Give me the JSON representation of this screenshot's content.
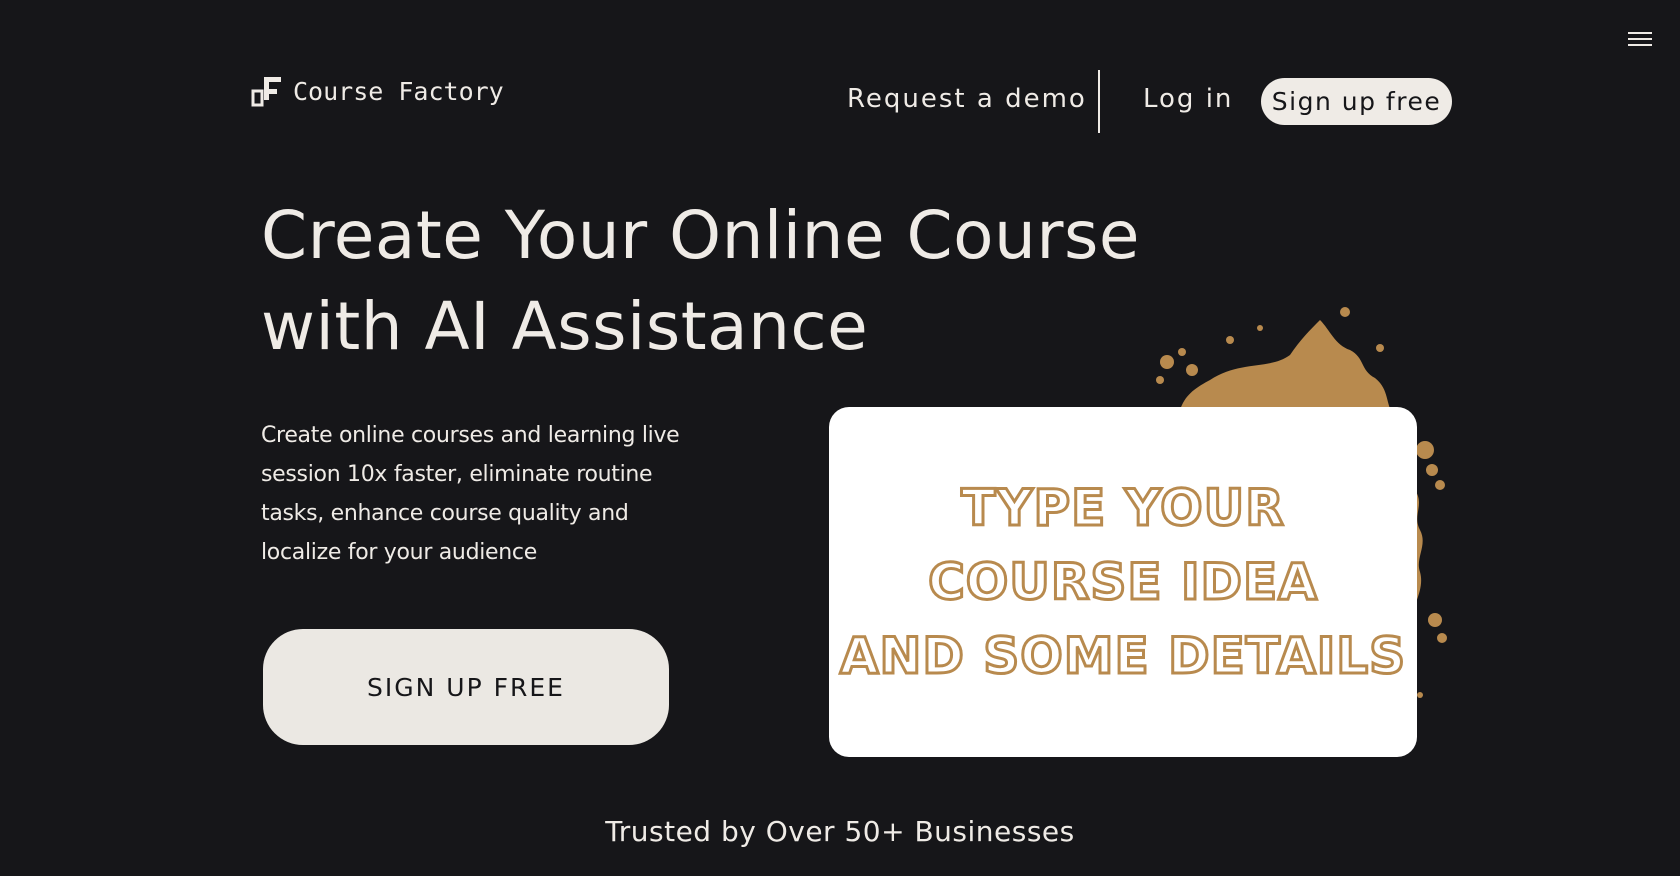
{
  "header": {
    "logo_text": "Course Factory",
    "nav": {
      "request_demo": "Request a demo",
      "login": "Log in",
      "signup": "Sign up free"
    }
  },
  "hero": {
    "title_line1": "Create Your Online Course",
    "title_line2": "with AI Assistance",
    "description": "Create online courses and learning live session 10x faster, eliminate routine tasks, enhance course quality and localize for your audience",
    "cta_label": "SIGN UP FREE"
  },
  "demo_card": {
    "lines": [
      "TYPE YOUR",
      "COURSE IDEA",
      "AND SOME DETAILS"
    ]
  },
  "trusted": {
    "text": "Trusted by Over 50+ Businesses"
  },
  "icons": {
    "menu": "hamburger-menu-icon",
    "logo": "course-factory-logo-icon",
    "decoration": "paint-splash"
  },
  "colors": {
    "background": "#161619",
    "foreground": "#efebe6",
    "button_bg": "#ebe8e3",
    "accent": "#b88a4e",
    "card_bg": "#ffffff"
  }
}
